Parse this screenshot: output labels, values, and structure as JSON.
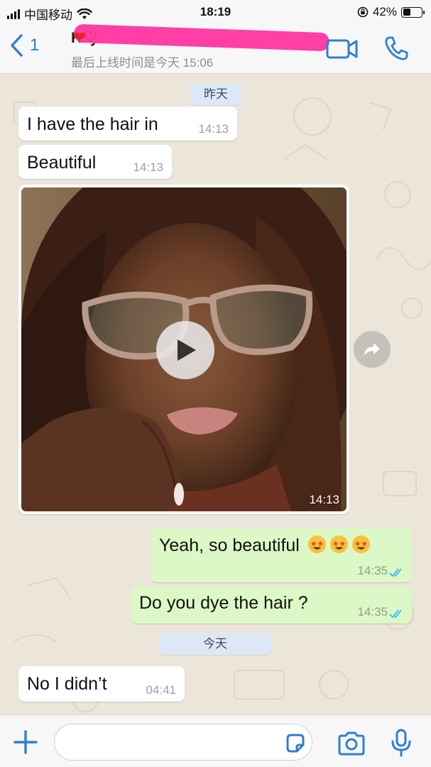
{
  "status_bar": {
    "carrier": "中国移动",
    "time": "18:19",
    "battery": "42%",
    "battery_level": 0.42
  },
  "header": {
    "back_count": "1",
    "contact_name": "Kay  Kevelinuu",
    "last_seen": "最后上线时间是今天 15:06",
    "icons": [
      "chevron-left-icon",
      "video-camera-icon",
      "phone-icon"
    ]
  },
  "chat": {
    "date_yesterday": "昨天",
    "date_today": "今天",
    "messages": [
      {
        "direction": "in",
        "text": "I have the hair in",
        "time": "14:13"
      },
      {
        "direction": "in",
        "text": "Beautiful",
        "time": "14:13"
      },
      {
        "direction": "in",
        "type": "video",
        "time": "14:13"
      },
      {
        "direction": "out",
        "text": "Yeah, so beautiful",
        "time": "14:35",
        "status": "read"
      },
      {
        "direction": "out",
        "text": "Do you dye the hair ?",
        "time": "14:35",
        "status": "read"
      },
      {
        "direction": "in",
        "text": "No I didn’t",
        "time": "04:41"
      }
    ]
  },
  "input_bar": {
    "placeholder": "",
    "icons": [
      "plus-icon",
      "sticker-icon",
      "camera-icon",
      "microphone-icon"
    ]
  },
  "colors": {
    "accent": "#2f7fd3",
    "incoming_bubble": "#ffffff",
    "outgoing_bubble": "#dcf8c6",
    "chat_background": "#ece5da",
    "read_ticks": "#34b7f1"
  }
}
